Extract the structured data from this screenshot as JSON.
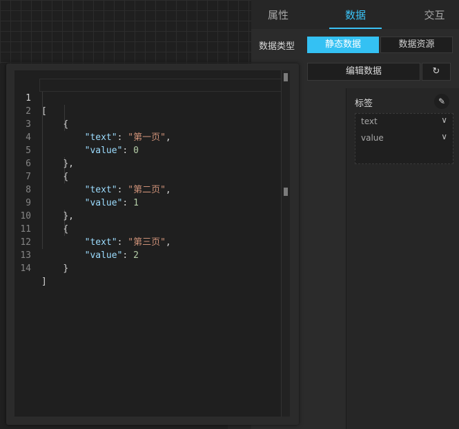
{
  "tabs": {
    "properties": "属性",
    "data": "数据",
    "interaction": "交互"
  },
  "data_type": {
    "label": "数据类型",
    "options": [
      "静态数据",
      "数据资源"
    ],
    "selected": "静态数据"
  },
  "edit_button": "编辑数据",
  "refresh_icon": "↻",
  "tags": {
    "title": "标签",
    "edit_icon": "✎",
    "items": [
      {
        "label": "text"
      },
      {
        "label": "value"
      }
    ]
  },
  "editor": {
    "lines": [
      {
        "n": "1"
      },
      {
        "n": "2"
      },
      {
        "n": "3"
      },
      {
        "n": "4"
      },
      {
        "n": "5"
      },
      {
        "n": "6"
      },
      {
        "n": "7"
      },
      {
        "n": "8"
      },
      {
        "n": "9"
      },
      {
        "n": "10"
      },
      {
        "n": "11"
      },
      {
        "n": "12"
      },
      {
        "n": "13"
      },
      {
        "n": "14"
      }
    ],
    "json_value": [
      {
        "text": "第一页",
        "value": "0"
      },
      {
        "text": "第二页",
        "value": "1"
      },
      {
        "text": "第三页",
        "value": "2"
      }
    ],
    "punct": {
      "open_array": "[",
      "close_array": "]",
      "open_obj": "{",
      "close_obj": "}",
      "close_obj_comma": "},"
    },
    "keys": {
      "text": "\"text\"",
      "value": "\"value\""
    }
  },
  "colors": {
    "accent": "#34c1f3",
    "tab_active": "#3bc3f6",
    "key": "#9cdcfe",
    "string": "#ce9178",
    "number": "#b5cea8"
  }
}
